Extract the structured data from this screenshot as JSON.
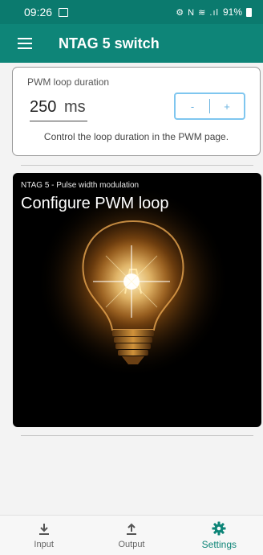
{
  "status_bar": {
    "time": "09:26",
    "indicators": "⚙ N ≋ .ıl",
    "battery_percent": "91%"
  },
  "app_bar": {
    "title": "NTAG 5 switch",
    "menu_icon": "hamburger-menu-icon"
  },
  "pwm_settings": {
    "label": "PWM loop duration",
    "value": "250",
    "unit": "ms",
    "decrement_label": "-",
    "increment_label": "+",
    "help_text": "Control the loop duration in the PWM page."
  },
  "hero_card": {
    "subtitle": "NTAG 5 - Pulse width modulation",
    "title": "Configure PWM loop",
    "image": "lightbulb-illustration"
  },
  "bottom_nav": {
    "items": [
      {
        "label": "Input",
        "icon": "download-icon",
        "active": false
      },
      {
        "label": "Output",
        "icon": "upload-icon",
        "active": false
      },
      {
        "label": "Settings",
        "icon": "gear-icon",
        "active": true
      }
    ]
  },
  "colors": {
    "primary": "#0e8578",
    "status_bar": "#0b7a6e",
    "stepper_accent": "#7fc6ef",
    "active_nav": "#0e8578"
  }
}
